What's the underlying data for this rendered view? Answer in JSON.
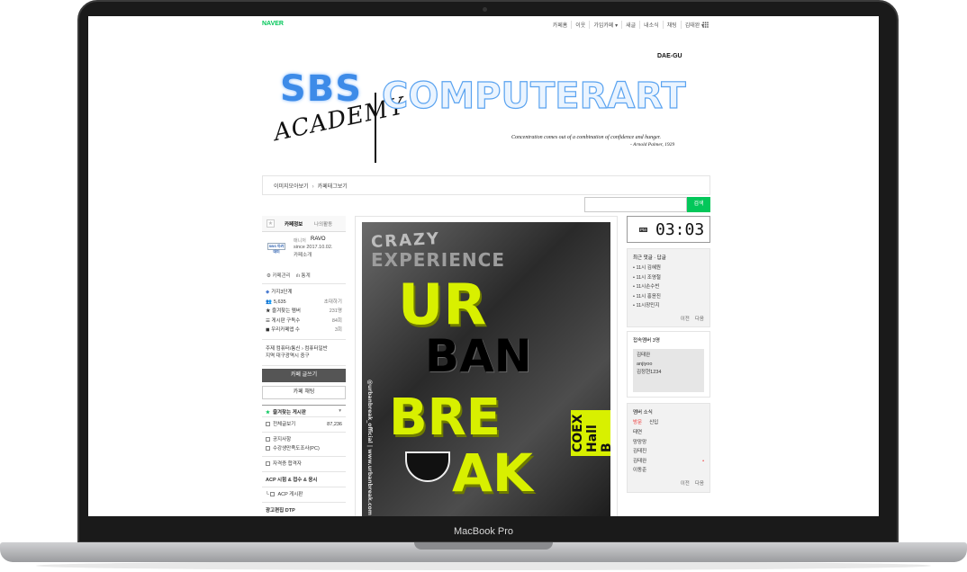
{
  "device": {
    "label": "MacBook Pro"
  },
  "topbar": {
    "brand": "NAVER",
    "nav": [
      "카페홈",
      "이웃",
      "가입카페 ▾",
      "새글",
      "내소식",
      "채팅",
      "김태완 ▾"
    ]
  },
  "banner": {
    "region": "DAE-GU",
    "sbs": "SBS",
    "academy": "ACADEMY",
    "title": "COMPUTERART",
    "quote": "Concentration comes out of a combination of confidence and hunger.",
    "quote_author": "- Arnold Palmer, 1929"
  },
  "breadcrumb": {
    "item1": "이미지모아보기",
    "sep": "›",
    "item2": "카페태그보기"
  },
  "search": {
    "placeholder": "",
    "button": "검색"
  },
  "sidebar": {
    "tab_info": "카페정보",
    "tab_activity": "나의활동",
    "logo_text": "SBS 아카데미",
    "manager_label": "매니저",
    "manager_name": "RAVO",
    "since": "since 2017.10.02.",
    "intro": "카페소개",
    "manage": "⚙ 카페관리",
    "stats_link": "ılı 통계",
    "level": "가지3단계",
    "members": "5,635",
    "invite": "초대하기",
    "fav_members_label": "즐겨찾는 멤버",
    "fav_members_count": "231명",
    "board_subs_label": "게시판 구독수",
    "board_subs_count": "84회",
    "cafe_app_label": "우리카페앱 수",
    "cafe_app_count": "3회",
    "topic": "주제 컴퓨터/통신 › 컴퓨터일반",
    "region": "지역 대구광역시 중구",
    "write_button": "카페 글쓰기",
    "chat_button": "카페 채팅",
    "fav_boards": "즐겨찾는 게시판",
    "all_posts": "전체글보기",
    "all_posts_count": "87,236",
    "menu1": "공지사항",
    "menu2": "수강생만족도조사(PC)",
    "menu3": "자격증 합격자",
    "section_acp": "ACP 시험 & 접수 & 응시",
    "menu4": "ACP 게시판",
    "section_ad": "광고편집 DTP"
  },
  "poster": {
    "crazy": "CRAZY",
    "experience": "EXPERIENCE",
    "ur": "UR",
    "ban": "BAN",
    "bre": "BRE",
    "ak": "AK",
    "venue": "COEX Hall B",
    "side_text": "@urbanbreak_official  |  www.urbanbreak.com"
  },
  "clock": {
    "ampm": "PM",
    "time": "03:03"
  },
  "recent_comments": {
    "title": "최근 댓글 · 답글",
    "items": [
      "11시 김혜원",
      "11시 조영철",
      "11시손수빈",
      "11시 홍윤진",
      "11시장민지"
    ],
    "prev": "이전",
    "next": "다음"
  },
  "online": {
    "title": "접속멤버 3명",
    "members": [
      "김태완",
      "anjiyoo",
      "김정현1234"
    ]
  },
  "member_news": {
    "title": "멤버 소식",
    "tab_visit": "방문",
    "tab_join": "신입",
    "items": [
      "태연",
      "망망망",
      "김태진",
      "김태완",
      "이동준"
    ],
    "prev": "이전",
    "next": "다음"
  },
  "colors": {
    "naver_green": "#03c75a",
    "poster_lime": "#d8f000",
    "sbs_blue": "#3d8be8"
  }
}
